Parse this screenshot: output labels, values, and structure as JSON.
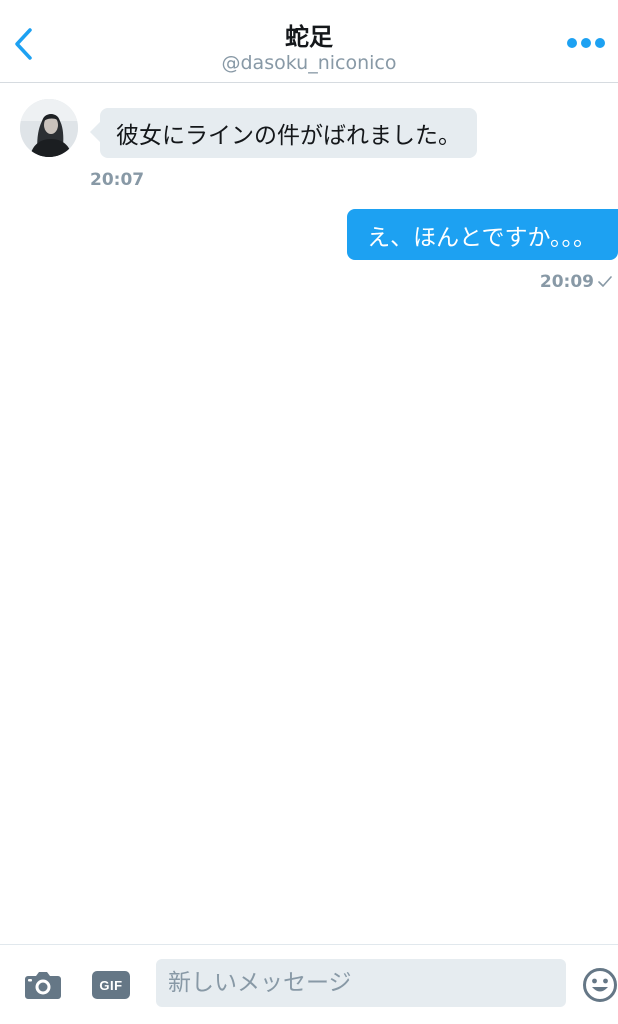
{
  "header": {
    "title": "蛇足",
    "handle": "@dasoku_niconico",
    "back_icon": "chevron-left-icon",
    "more_icon": "more-dots-icon"
  },
  "messages": [
    {
      "direction": "incoming",
      "text": "彼女にラインの件がばれました。",
      "time": "20:07"
    },
    {
      "direction": "outgoing",
      "text": "え、ほんとですか。。。",
      "time": "20:09",
      "read_icon": "checkmark-icon"
    }
  ],
  "composer": {
    "camera_icon": "camera-icon",
    "gif_label": "GIF",
    "placeholder": "新しいメッセージ",
    "emoji_icon": "smiley-icon"
  },
  "colors": {
    "accent": "#1da1f2",
    "incoming_bubble": "#e6ecf0",
    "muted_text": "#8899a6",
    "icon_gray": "#657786"
  }
}
